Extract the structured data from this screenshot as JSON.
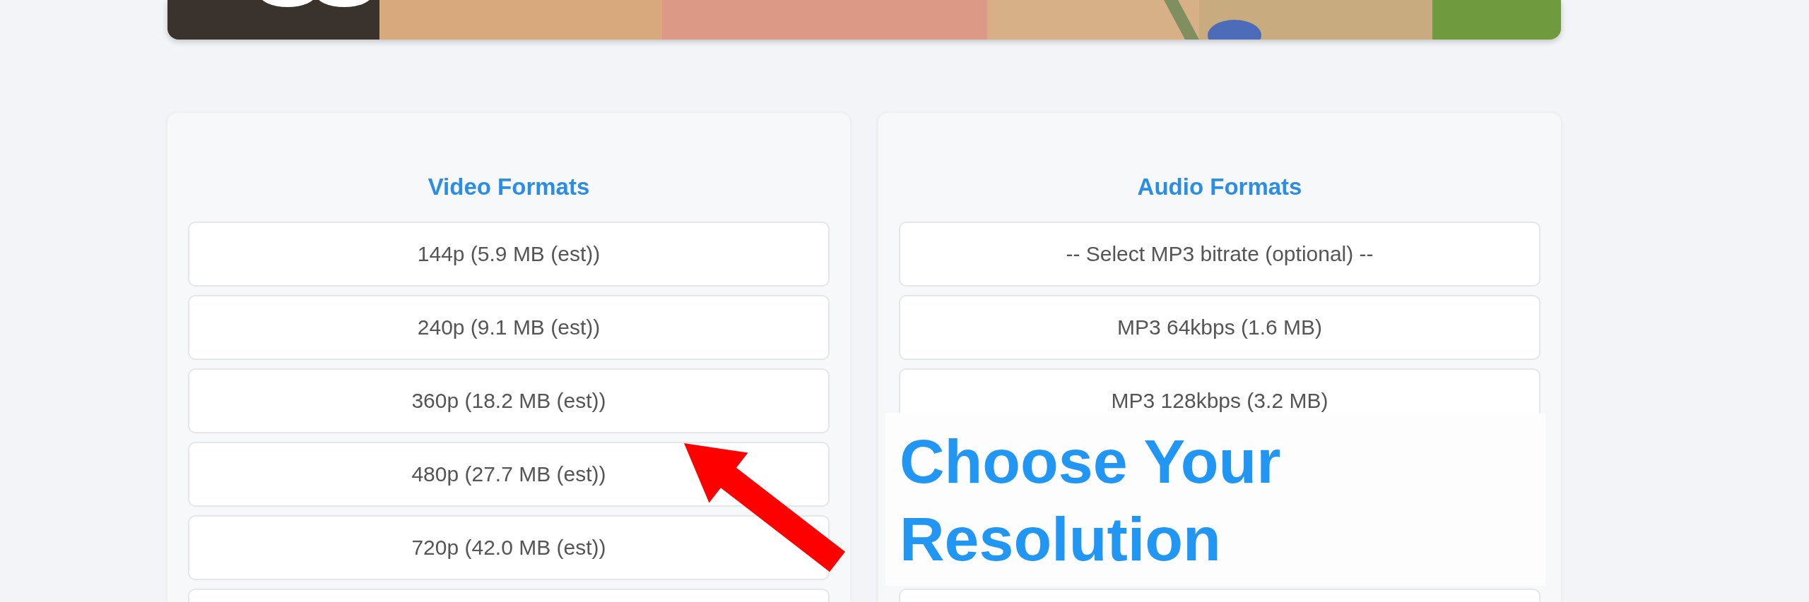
{
  "cards": [
    {
      "title": "Video Formats",
      "options": [
        {
          "kind": "option",
          "label": "144p (5.9 MB (est))"
        },
        {
          "kind": "option",
          "label": "240p (9.1 MB (est))"
        },
        {
          "kind": "option",
          "label": "360p (18.2 MB (est))"
        },
        {
          "kind": "option",
          "label": "480p (27.7 MB (est))"
        },
        {
          "kind": "option",
          "label": "720p (42.0 MB (est))"
        },
        {
          "kind": "partial"
        }
      ]
    },
    {
      "title": "Audio Formats",
      "options": [
        {
          "kind": "option",
          "label": "-- Select MP3 bitrate (optional) --"
        },
        {
          "kind": "option",
          "label": "MP3 64kbps (1.6 MB)"
        },
        {
          "kind": "option",
          "label": "MP3 128kbps (3.2 MB)"
        },
        {
          "kind": "covered"
        },
        {
          "kind": "covered"
        },
        {
          "kind": "partial"
        }
      ]
    }
  ],
  "callout": {
    "text": "Choose Your Resolution"
  }
}
